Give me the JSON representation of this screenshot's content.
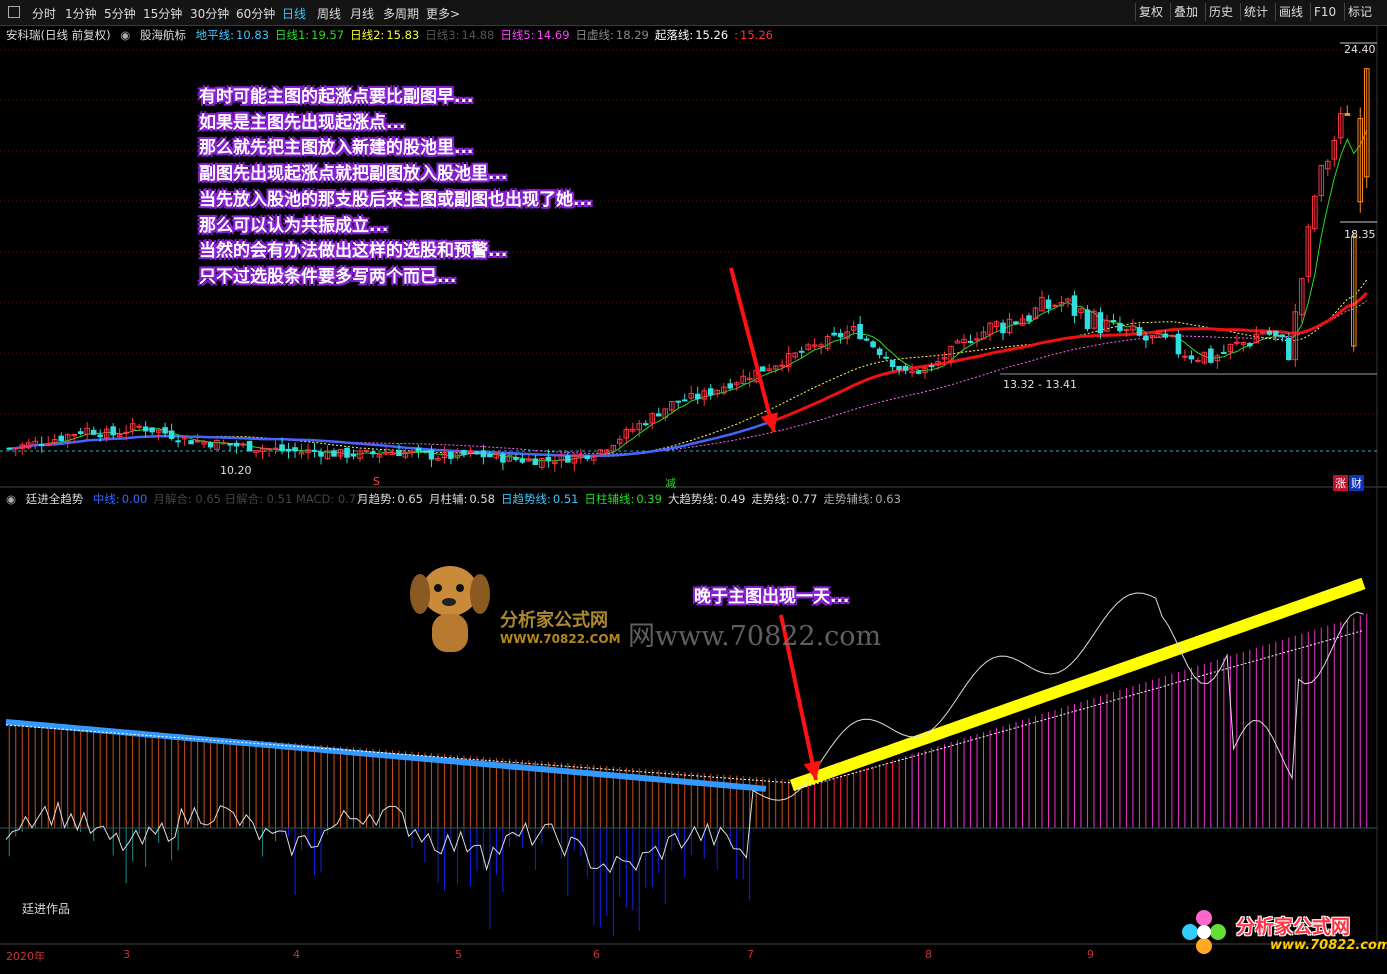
{
  "toolbar": {
    "periods": [
      "分时",
      "1分钟",
      "5分钟",
      "15分钟",
      "30分钟",
      "60分钟",
      "日线",
      "周线",
      "月线",
      "多周期",
      "更多>"
    ],
    "active": "日线",
    "right": [
      "复权",
      "叠加",
      "历史",
      "统计",
      "画线",
      "F10",
      "标记"
    ]
  },
  "main_panel": {
    "stock": "安科瑞(日线 前复权)",
    "indicator": "股海航标",
    "legend": [
      {
        "label": "地平线:",
        "value": "10.83",
        "color": "#3ec7ff"
      },
      {
        "label": "日线1:",
        "value": "19.57",
        "color": "#22dd22"
      },
      {
        "label": "日线2:",
        "value": "15.83",
        "color": "#ffff33"
      },
      {
        "label": "日线3:",
        "value": "14.88",
        "color": "#555555"
      },
      {
        "label": "日线5:",
        "value": "14.69",
        "color": "#ff44ff"
      },
      {
        "label": "日虚线:",
        "value": "18.29",
        "color": "#888888"
      },
      {
        "label": "起落线:",
        "value": "15.26",
        "color": "#ffffff"
      },
      {
        "label": ":",
        "value": "15.26",
        "color": "#ff3333"
      }
    ],
    "price_high": "24.40",
    "price_mid": "18.35",
    "price_low": "10.20",
    "range_label": "13.32 - 13.41",
    "marker_s": "S",
    "marker_jian": "减",
    "corner_tags": [
      "涨",
      "财"
    ]
  },
  "annotation_main": [
    "有时可能主图的起涨点要比副图早...",
    "如果是主图先出现起涨点...",
    "那么就先把主图放入新建的股池里...",
    "副图先出现起涨点就把副图放入股池里...",
    "当先放入股池的那支股后来主图或副图也出现了她...",
    "那么可以认为共振成立...",
    "当然的会有办法做出这样的选股和预警...",
    "只不过选股条件要多写两个而已..."
  ],
  "sub_panel": {
    "indicator": "廷进全趋势",
    "legend": [
      {
        "label": "中线:",
        "value": "0.00",
        "color": "#3366ff"
      },
      {
        "label": "月趋势:",
        "value": "0.65",
        "color": "#dddddd"
      },
      {
        "label": "月柱辅:",
        "value": "0.58",
        "color": "#dddddd"
      },
      {
        "label": "日趋势线:",
        "value": "0.51",
        "color": "#3ec7ff"
      },
      {
        "label": "日柱辅线:",
        "value": "0.39",
        "color": "#22dd22"
      },
      {
        "label": "大趋势线:",
        "value": "0.49",
        "color": "#dddddd"
      },
      {
        "label": "走势线:",
        "value": "0.77",
        "color": "#dddddd"
      },
      {
        "label": "走势辅线:",
        "value": "0.63",
        "color": "#aaaaaa"
      }
    ],
    "faded_legend": "月解合: 0.65  日解合: 0.51  MACD: 0.77",
    "annotation": "晚于主图出现一天...",
    "author": "廷进作品"
  },
  "watermark": {
    "brand": "分析家公式网",
    "url_small": "WWW.70822.COM",
    "url_large": "网www.70822.com",
    "corner_brand": "分析家公式网",
    "corner_url": "www.70822.com"
  },
  "x_axis": [
    "2020年",
    "3",
    "4",
    "5",
    "6",
    "7",
    "8",
    "9"
  ],
  "chart_data": {
    "type": "candlestick",
    "x_axis_labels": [
      "2020年",
      "3",
      "4",
      "5",
      "6",
      "7",
      "8",
      "9"
    ],
    "y_labels": [
      "10.20",
      "18.35",
      "24.40"
    ],
    "close_series": [
      10.7,
      10.9,
      11.1,
      11.4,
      11.2,
      11.5,
      11.3,
      11.0,
      10.9,
      10.8,
      10.7,
      10.6,
      10.6,
      10.5,
      10.5,
      10.6,
      10.5,
      10.4,
      10.5,
      10.4,
      10.3,
      10.3,
      10.4,
      10.6,
      11.2,
      11.8,
      12.4,
      12.6,
      13.0,
      13.4,
      13.8,
      14.2,
      14.6,
      15.0,
      14.2,
      13.4,
      13.6,
      14.4,
      14.9,
      15.3,
      15.6,
      16.0,
      15.5,
      15.0,
      14.7,
      14.5,
      14.2,
      14.0,
      14.4,
      15.0,
      14.2,
      20.0,
      22.5,
      24.4
    ],
    "sub_indicator": {
      "name": "廷进全趋势",
      "mid_line": 0.0,
      "values_last": {
        "月趋势": 0.65,
        "月柱辅": 0.58,
        "日趋势线": 0.51,
        "日柱辅线": 0.39,
        "大趋势线": 0.49,
        "走势线": 0.77,
        "走势辅线": 0.63
      }
    }
  }
}
